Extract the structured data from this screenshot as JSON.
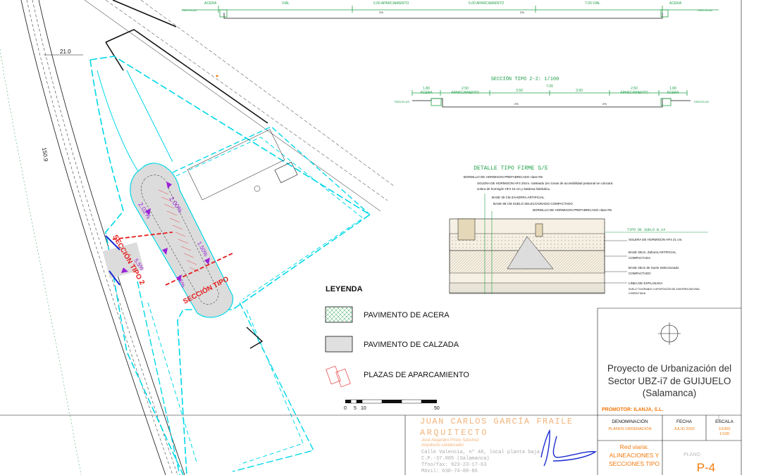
{
  "colors": {
    "road": "#00d8e8",
    "drawing": "#111111",
    "dim_green": "#22a04a",
    "purple": "#9a22d6",
    "red": "#e41b1b",
    "orange": "#f07a0e",
    "blue": "#1a2cd0"
  },
  "top_section": {
    "labels": [
      "PARCELAS",
      "ACERA",
      "VIAL",
      "5.00 APARCAMIENTO",
      "5.00 APARCAMIENTO",
      "7.00 VIAL",
      "ACERA",
      "PARCELAS"
    ],
    "slopes": [
      "2%",
      "2%"
    ]
  },
  "section_2": {
    "title": "SECCIÓN TIPO 2-2: 1/100",
    "dims": [
      "1.80",
      "2.50",
      "7.00",
      "2.50",
      "1.80"
    ],
    "sub_dims": [
      "3.50",
      "3.50"
    ],
    "labels": [
      "PARCELAS",
      "ACERA",
      "APARCAMIENTO",
      "APARCAMIENTO",
      "ACERA",
      "PARCELAS"
    ],
    "slopes": [
      "2%",
      "2%"
    ]
  },
  "firme": {
    "title": "DETALLE TIPO FIRME S/E",
    "notes": [
      "BORDILLO DE HORMIGON PREFABRICADO clase R5",
      "SOLERA DE HORMIGON HF4 20cm. ruleteado (en zonas de accesibilidad peatonal se colocará",
      "solera de hormigón HF4 15 cm y baldosa hidráulica.",
      "BASE 30 CM ZAHORRA ARTIFICIAL",
      "BASE 85 CM SUELO SELECCIONADO COMPACTADO",
      "BORDILLO DE HORMIGON PREFABRICADO clase R5"
    ],
    "suelo_title": "TIPO DE SUELO B.14",
    "suelo_notes": [
      "SOLERA DE HORMIGON HF4    21 cm.",
      "BASE 30cm. Zahorra ARTIFICIAL",
      "COMPACTADA",
      "BASE 45cm de Suelo Seleccionado",
      "COMPACTADO",
      "LINEA DE EXPLANADA",
      "SUELO TOLERABLE O APORTACIÓN DE ZAHORRA NATURAL",
      "COMPACTADA"
    ]
  },
  "plan": {
    "dim_21": "21.0",
    "dim_150": "150.9",
    "slopes": [
      "2.00%",
      "2.02%",
      "5.5%",
      "1.50%",
      "1.5%"
    ],
    "seccion_labels": [
      "SECCIÓN TIPO 2",
      "SECCIÓN TIPO"
    ]
  },
  "legend": {
    "title": "LEYENDA",
    "items": [
      "PAVIMENTO DE ACERA",
      "PAVIMENTO DE CALZADA",
      "PLAZAS DE APARCAMIENTO"
    ],
    "scale_labels": [
      "0",
      "5",
      "10",
      "50"
    ]
  },
  "titleblock": {
    "project": [
      "Proyecto de Urbanización del",
      "Sector UBZ-i7 de GUIJUELO",
      "(Salamanca)"
    ],
    "promotor": "PROMOTOR: ILANJA, S.L.",
    "architect": "JUAN CARLOS GARCÍA FRAILE",
    "arquitecto": "ARQUITECTO",
    "collaborator": [
      "José Alejandro Prieto Sánchez",
      "Arquitecto colaborador"
    ],
    "address": [
      "Calle Valencia, nº 48, local planta baja.",
      "C.P.-37.005 (Salamanca)",
      "Tfno/fax: 923-23-17-63",
      "Móvil: 630-74-88-86"
    ],
    "denominacion_label": "DENOMINACIÓN",
    "denominacion_value": "PLANOS ORDENACIÓN",
    "fecha_label": "FECHA",
    "fecha_value": "JULIO 2020",
    "escala_label": "ESCALA",
    "escala_values": [
      "1/1000",
      "1/100"
    ],
    "plano_title": [
      "Red viaria:",
      "ALINEACIONES Y",
      "SECCIONES TIPO"
    ],
    "plano_label": "PLANO",
    "plano_value": "P-4"
  }
}
